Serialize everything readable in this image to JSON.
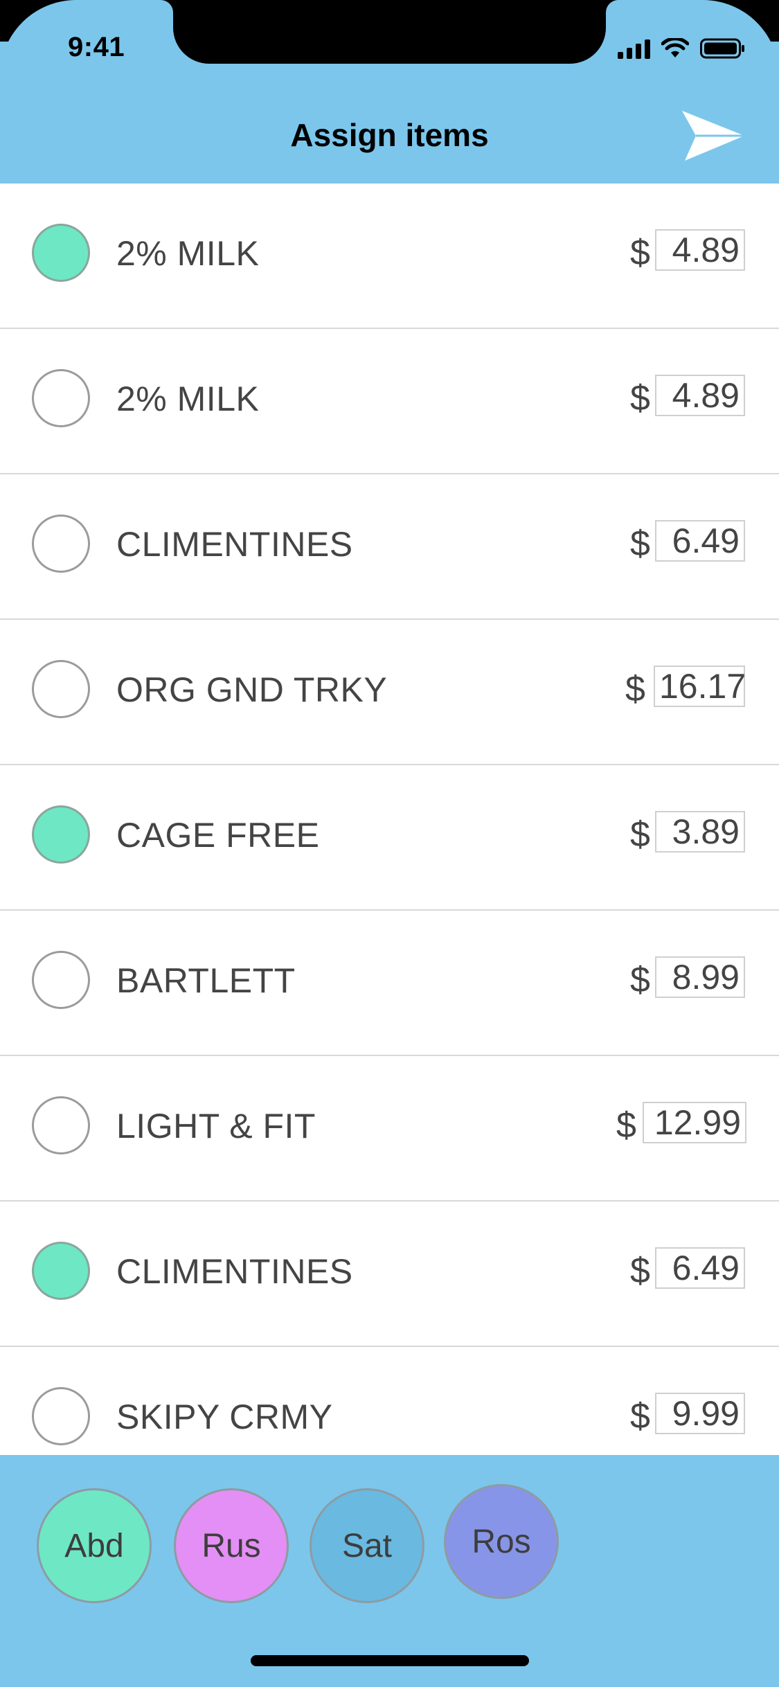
{
  "status_bar": {
    "time": "9:41"
  },
  "header": {
    "title": "Assign items",
    "send_icon": "send-icon"
  },
  "items": [
    {
      "name": "2% MILK",
      "currency": "$",
      "price": "4.89",
      "selected": true
    },
    {
      "name": "2% MILK",
      "currency": "$",
      "price": "4.89",
      "selected": false
    },
    {
      "name": "CLIMENTINES",
      "currency": "$",
      "price": "6.49",
      "selected": false
    },
    {
      "name": "ORG GND TRKY",
      "currency": "$",
      "price": "16.17",
      "selected": false
    },
    {
      "name": "CAGE FREE",
      "currency": "$",
      "price": "3.89",
      "selected": true
    },
    {
      "name": "BARTLETT",
      "currency": "$",
      "price": "8.99",
      "selected": false
    },
    {
      "name": "LIGHT & FIT",
      "currency": "$",
      "price": "12.99",
      "selected": false
    },
    {
      "name": "CLIMENTINES",
      "currency": "$",
      "price": "6.49",
      "selected": true
    },
    {
      "name": "SKIPY CRMY",
      "currency": "$",
      "price": "9.99",
      "selected": false
    }
  ],
  "people": [
    {
      "label": "Abd",
      "color": "#6ee7c5"
    },
    {
      "label": "Rus",
      "color": "#e48ff5"
    },
    {
      "label": "Sat",
      "color": "#69b9e0"
    },
    {
      "label": "Ros",
      "color": "#8795e8"
    }
  ],
  "colors": {
    "header": "#7cc6ec",
    "selected": "#6ee7c5"
  }
}
